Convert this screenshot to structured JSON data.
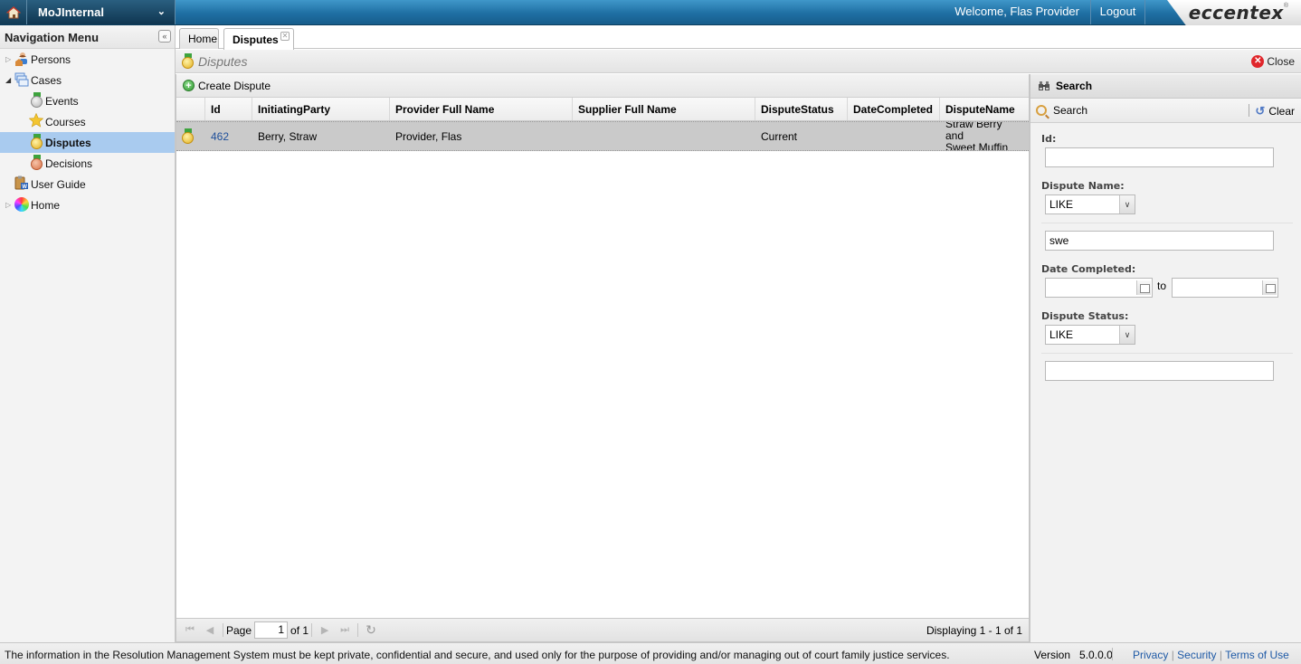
{
  "topbar": {
    "app_name": "MoJInternal",
    "welcome": "Welcome, Flas Provider",
    "logout": "Logout",
    "logo": "eccentex",
    "logo_mark": "®"
  },
  "sidebar": {
    "title": "Navigation Menu",
    "items": [
      {
        "label": "Persons",
        "icon": "persons-icon",
        "expanded": false
      },
      {
        "label": "Cases",
        "icon": "cases-icon",
        "expanded": true
      },
      {
        "label": "Events",
        "icon": "medal-silver-icon"
      },
      {
        "label": "Courses",
        "icon": "star-icon"
      },
      {
        "label": "Disputes",
        "icon": "medal-gold-icon",
        "selected": true
      },
      {
        "label": "Decisions",
        "icon": "medal-bronze-icon"
      },
      {
        "label": "User Guide",
        "icon": "user-guide-icon"
      },
      {
        "label": "Home",
        "icon": "color-wheel-icon",
        "expanded": false
      }
    ]
  },
  "tabs": [
    {
      "label": "Home",
      "active": false
    },
    {
      "label": "Disputes",
      "active": true,
      "closable": true
    }
  ],
  "page": {
    "title": "Disputes",
    "close_label": "Close"
  },
  "grid": {
    "create_label": "Create Dispute",
    "columns": [
      "",
      "Id",
      "InitiatingParty",
      "Provider Full Name",
      "Supplier Full Name",
      "DisputeStatus",
      "DateCompleted",
      "DisputeName"
    ],
    "rows": [
      {
        "id": "462",
        "initiating_party": "Berry, Straw",
        "provider_full_name": "Provider, Flas",
        "supplier_full_name": "",
        "dispute_status": "Current",
        "date_completed": "",
        "dispute_name_line1": "Straw Berry and",
        "dispute_name_line2": "Sweet Muffin",
        "selected": true
      }
    ],
    "pager": {
      "page_label": "Page",
      "page_value": "1",
      "of_label": "of 1",
      "display_text": "Displaying 1 - 1 of 1"
    }
  },
  "search": {
    "title": "Search",
    "search_label": "Search",
    "clear_label": "Clear",
    "fields": {
      "id_label": "Id:",
      "id_value": "",
      "dispute_name_label": "Dispute Name:",
      "dispute_name_op": "LIKE",
      "dispute_name_value": "swe",
      "date_completed_label": "Date Completed:",
      "date_from": "",
      "date_to_label": "to",
      "date_to": "",
      "dispute_status_label": "Dispute Status:",
      "dispute_status_op": "LIKE",
      "dispute_status_value": ""
    }
  },
  "footer": {
    "notice": "The information in the Resolution Management System must be kept private, confidential and secure, and used only for the purpose of providing and/or managing out of court family justice services.",
    "version_label": "Version",
    "version_value": "5.0.0.0",
    "links": [
      "Privacy",
      "Security",
      "Terms of Use"
    ],
    "link_sep": "|"
  }
}
